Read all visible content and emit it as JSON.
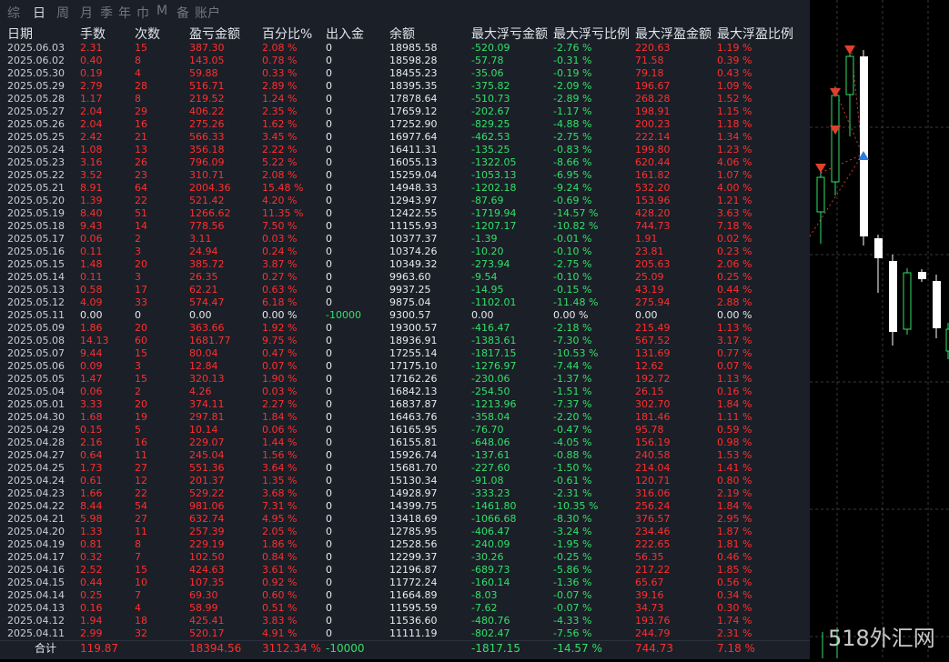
{
  "tabs": [
    "综",
    "日",
    "周",
    "月",
    "季",
    "年",
    "巾",
    "M",
    "备",
    "账户"
  ],
  "active_tab": 1,
  "headers": [
    "日期",
    "手数",
    "次数",
    "盈亏金额",
    "百分比%",
    "出入金",
    "余额",
    "最大浮亏金额",
    "最大浮亏比例",
    "最大浮盈金额",
    "最大浮盈比例"
  ],
  "rows": [
    [
      "2025.06.03",
      "2.31",
      "15",
      "387.30",
      "2.08 %",
      "0",
      "18985.58",
      "-520.09",
      "-2.76 %",
      "220.63",
      "1.19 %"
    ],
    [
      "2025.06.02",
      "0.40",
      "8",
      "143.05",
      "0.78 %",
      "0",
      "18598.28",
      "-57.78",
      "-0.31 %",
      "71.58",
      "0.39 %"
    ],
    [
      "2025.05.30",
      "0.19",
      "4",
      "59.88",
      "0.33 %",
      "0",
      "18455.23",
      "-35.06",
      "-0.19 %",
      "79.18",
      "0.43 %"
    ],
    [
      "2025.05.29",
      "2.79",
      "28",
      "516.71",
      "2.89 %",
      "0",
      "18395.35",
      "-375.82",
      "-2.09 %",
      "196.67",
      "1.09 %"
    ],
    [
      "2025.05.28",
      "1.17",
      "8",
      "219.52",
      "1.24 %",
      "0",
      "17878.64",
      "-510.73",
      "-2.89 %",
      "268.28",
      "1.52 %"
    ],
    [
      "2025.05.27",
      "2.04",
      "29",
      "406.22",
      "2.35 %",
      "0",
      "17659.12",
      "-202.67",
      "-1.17 %",
      "198.91",
      "1.15 %"
    ],
    [
      "2025.05.26",
      "2.04",
      "16",
      "275.26",
      "1.62 %",
      "0",
      "17252.90",
      "-829.25",
      "-4.88 %",
      "200.23",
      "1.18 %"
    ],
    [
      "2025.05.25",
      "2.42",
      "21",
      "566.33",
      "3.45 %",
      "0",
      "16977.64",
      "-462.53",
      "-2.75 %",
      "222.14",
      "1.34 %"
    ],
    [
      "2025.05.24",
      "1.08",
      "13",
      "356.18",
      "2.22 %",
      "0",
      "16411.31",
      "-135.25",
      "-0.83 %",
      "199.80",
      "1.23 %"
    ],
    [
      "2025.05.23",
      "3.16",
      "26",
      "796.09",
      "5.22 %",
      "0",
      "16055.13",
      "-1322.05",
      "-8.66 %",
      "620.44",
      "4.06 %"
    ],
    [
      "2025.05.22",
      "3.52",
      "23",
      "310.71",
      "2.08 %",
      "0",
      "15259.04",
      "-1053.13",
      "-6.95 %",
      "161.82",
      "1.07 %"
    ],
    [
      "2025.05.21",
      "8.91",
      "64",
      "2004.36",
      "15.48 %",
      "0",
      "14948.33",
      "-1202.18",
      "-9.24 %",
      "532.20",
      "4.00 %"
    ],
    [
      "2025.05.20",
      "1.39",
      "22",
      "521.42",
      "4.20 %",
      "0",
      "12943.97",
      "-87.69",
      "-0.69 %",
      "153.96",
      "1.21 %"
    ],
    [
      "2025.05.19",
      "8.40",
      "51",
      "1266.62",
      "11.35 %",
      "0",
      "12422.55",
      "-1719.94",
      "-14.57 %",
      "428.20",
      "3.63 %"
    ],
    [
      "2025.05.18",
      "9.43",
      "14",
      "778.56",
      "7.50 %",
      "0",
      "11155.93",
      "-1207.17",
      "-10.82 %",
      "744.73",
      "7.18 %"
    ],
    [
      "2025.05.17",
      "0.06",
      "2",
      "3.11",
      "0.03 %",
      "0",
      "10377.37",
      "-1.39",
      "-0.01 %",
      "1.91",
      "0.02 %"
    ],
    [
      "2025.05.16",
      "0.11",
      "3",
      "24.94",
      "0.24 %",
      "0",
      "10374.26",
      "-10.20",
      "-0.10 %",
      "23.81",
      "0.23 %"
    ],
    [
      "2025.05.15",
      "1.48",
      "20",
      "385.72",
      "3.87 %",
      "0",
      "10349.32",
      "-273.94",
      "-2.75 %",
      "205.63",
      "2.06 %"
    ],
    [
      "2025.05.14",
      "0.11",
      "3",
      "26.35",
      "0.27 %",
      "0",
      "9963.60",
      "-9.54",
      "-0.10 %",
      "25.09",
      "0.25 %"
    ],
    [
      "2025.05.13",
      "0.58",
      "17",
      "62.21",
      "0.63 %",
      "0",
      "9937.25",
      "-14.95",
      "-0.15 %",
      "43.19",
      "0.44 %"
    ],
    [
      "2025.05.12",
      "4.09",
      "33",
      "574.47",
      "6.18 %",
      "0",
      "9875.04",
      "-1102.01",
      "-11.48 %",
      "275.94",
      "2.88 %"
    ],
    [
      "2025.05.11",
      "0.00",
      "0",
      "0.00",
      "0.00 %",
      "-10000",
      "9300.57",
      "0.00",
      "0.00 %",
      "0.00",
      "0.00 %"
    ],
    [
      "2025.05.09",
      "1.86",
      "20",
      "363.66",
      "1.92 %",
      "0",
      "19300.57",
      "-416.47",
      "-2.18 %",
      "215.49",
      "1.13 %"
    ],
    [
      "2025.05.08",
      "14.13",
      "60",
      "1681.77",
      "9.75 %",
      "0",
      "18936.91",
      "-1383.61",
      "-7.30 %",
      "567.52",
      "3.17 %"
    ],
    [
      "2025.05.07",
      "9.44",
      "15",
      "80.04",
      "0.47 %",
      "0",
      "17255.14",
      "-1817.15",
      "-10.53 %",
      "131.69",
      "0.77 %"
    ],
    [
      "2025.05.06",
      "0.09",
      "3",
      "12.84",
      "0.07 %",
      "0",
      "17175.10",
      "-1276.97",
      "-7.44 %",
      "12.62",
      "0.07 %"
    ],
    [
      "2025.05.05",
      "1.47",
      "15",
      "320.13",
      "1.90 %",
      "0",
      "17162.26",
      "-230.06",
      "-1.37 %",
      "192.72",
      "1.13 %"
    ],
    [
      "2025.05.04",
      "0.06",
      "2",
      "4.26",
      "0.03 %",
      "0",
      "16842.13",
      "-254.50",
      "-1.51 %",
      "26.15",
      "0.16 %"
    ],
    [
      "2025.05.01",
      "3.33",
      "20",
      "374.11",
      "2.27 %",
      "0",
      "16837.87",
      "-1213.96",
      "-7.37 %",
      "302.70",
      "1.84 %"
    ],
    [
      "2025.04.30",
      "1.68",
      "19",
      "297.81",
      "1.84 %",
      "0",
      "16463.76",
      "-358.04",
      "-2.20 %",
      "181.46",
      "1.11 %"
    ],
    [
      "2025.04.29",
      "0.15",
      "5",
      "10.14",
      "0.06 %",
      "0",
      "16165.95",
      "-76.70",
      "-0.47 %",
      "95.78",
      "0.59 %"
    ],
    [
      "2025.04.28",
      "2.16",
      "16",
      "229.07",
      "1.44 %",
      "0",
      "16155.81",
      "-648.06",
      "-4.05 %",
      "156.19",
      "0.98 %"
    ],
    [
      "2025.04.27",
      "0.64",
      "11",
      "245.04",
      "1.56 %",
      "0",
      "15926.74",
      "-137.61",
      "-0.88 %",
      "240.58",
      "1.53 %"
    ],
    [
      "2025.04.25",
      "1.73",
      "27",
      "551.36",
      "3.64 %",
      "0",
      "15681.70",
      "-227.60",
      "-1.50 %",
      "214.04",
      "1.41 %"
    ],
    [
      "2025.04.24",
      "0.61",
      "12",
      "201.37",
      "1.35 %",
      "0",
      "15130.34",
      "-91.08",
      "-0.61 %",
      "120.71",
      "0.80 %"
    ],
    [
      "2025.04.23",
      "1.66",
      "22",
      "529.22",
      "3.68 %",
      "0",
      "14928.97",
      "-333.23",
      "-2.31 %",
      "316.06",
      "2.19 %"
    ],
    [
      "2025.04.22",
      "8.44",
      "54",
      "981.06",
      "7.31 %",
      "0",
      "14399.75",
      "-1461.80",
      "-10.35 %",
      "256.24",
      "1.84 %"
    ],
    [
      "2025.04.21",
      "5.98",
      "27",
      "632.74",
      "4.95 %",
      "0",
      "13418.69",
      "-1066.68",
      "-8.30 %",
      "376.57",
      "2.95 %"
    ],
    [
      "2025.04.20",
      "1.33",
      "11",
      "257.39",
      "2.05 %",
      "0",
      "12785.95",
      "-406.47",
      "-3.24 %",
      "234.46",
      "1.87 %"
    ],
    [
      "2025.04.19",
      "0.81",
      "8",
      "229.19",
      "1.86 %",
      "0",
      "12528.56",
      "-240.09",
      "-1.95 %",
      "222.65",
      "1.81 %"
    ],
    [
      "2025.04.17",
      "0.32",
      "7",
      "102.50",
      "0.84 %",
      "0",
      "12299.37",
      "-30.26",
      "-0.25 %",
      "56.35",
      "0.46 %"
    ],
    [
      "2025.04.16",
      "2.52",
      "15",
      "424.63",
      "3.61 %",
      "0",
      "12196.87",
      "-689.73",
      "-5.86 %",
      "217.22",
      "1.85 %"
    ],
    [
      "2025.04.15",
      "0.44",
      "10",
      "107.35",
      "0.92 %",
      "0",
      "11772.24",
      "-160.14",
      "-1.36 %",
      "65.67",
      "0.56 %"
    ],
    [
      "2025.04.14",
      "0.25",
      "7",
      "69.30",
      "0.60 %",
      "0",
      "11664.89",
      "-8.03",
      "-0.07 %",
      "39.16",
      "0.34 %"
    ],
    [
      "2025.04.13",
      "0.16",
      "4",
      "58.99",
      "0.51 %",
      "0",
      "11595.59",
      "-7.62",
      "-0.07 %",
      "34.73",
      "0.30 %"
    ],
    [
      "2025.04.12",
      "1.94",
      "18",
      "425.41",
      "3.83 %",
      "0",
      "11536.60",
      "-480.76",
      "-4.33 %",
      "193.76",
      "1.74 %"
    ],
    [
      "2025.04.11",
      "2.99",
      "32",
      "520.17",
      "4.91 %",
      "0",
      "11111.19",
      "-802.47",
      "-7.56 %",
      "244.79",
      "2.31 %"
    ]
  ],
  "footer": [
    "合计",
    "119.87",
    "",
    "18394.56",
    "3112.34 %",
    "-10000",
    "",
    "-1817.15",
    "-14.57 %",
    "744.73",
    "7.18 %"
  ],
  "watermark": "518外汇网",
  "colors": {
    "panel_bg": "#1b1f27",
    "profit_red": "#ff2f2f",
    "loss_green": "#31e06a",
    "bull_candle": "#31e06a",
    "bear_candle": "#ffffff",
    "sell_arrow": "#e0402a",
    "buy_arrow": "#2a7fe0"
  }
}
